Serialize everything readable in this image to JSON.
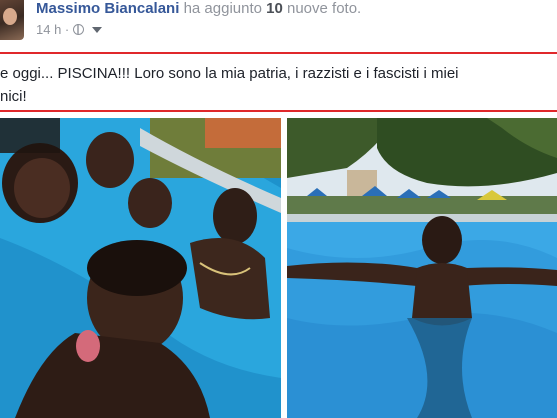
{
  "post": {
    "author": "Massimo Biancalani",
    "action": "ha aggiunto",
    "photo_count": "10",
    "photo_word": "nuove foto.",
    "time": "14 h ·",
    "text_line1": "e oggi... PISCINA!!! Loro sono la mia patria, i razzisti e i fascisti i miei",
    "text_line2": "nici!"
  },
  "icons": {
    "audience": "globe-icon",
    "menu": "chevron-down-icon"
  },
  "colors": {
    "author_link": "#365899",
    "highlight_border": "#e0282b",
    "pool_water": "#2a9fd6"
  }
}
